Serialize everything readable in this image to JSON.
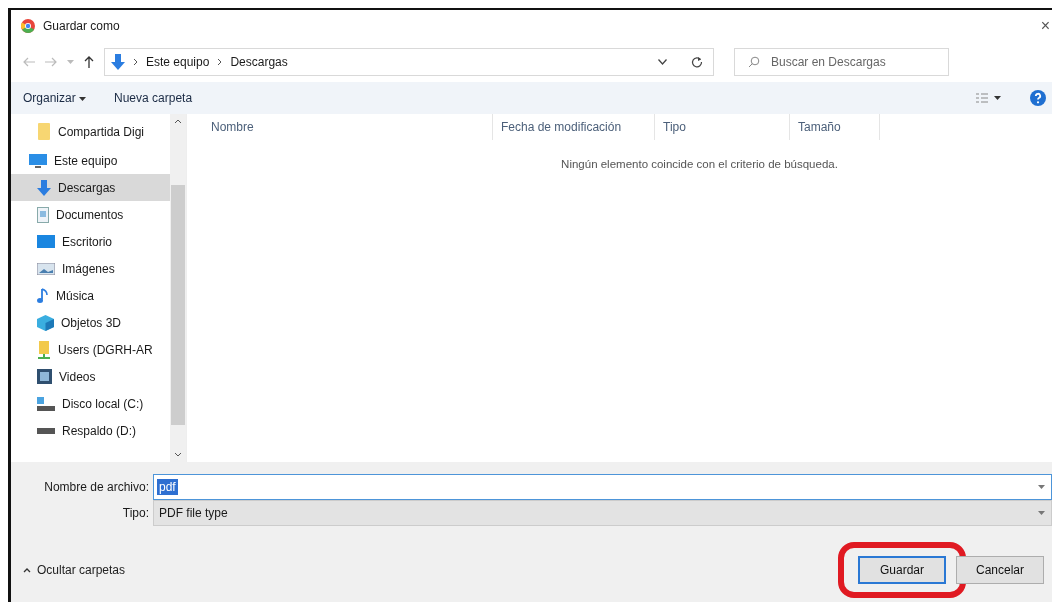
{
  "window": {
    "title": "Guardar como",
    "close": "×"
  },
  "address_bar": {
    "path": [
      {
        "label": "Este equipo"
      },
      {
        "label": "Descargas"
      }
    ],
    "search_placeholder": "Buscar en Descargas"
  },
  "toolbar": {
    "organize": "Organizar",
    "new_folder": "Nueva carpeta"
  },
  "sidebar": {
    "items": [
      {
        "label": "Compartida Digi",
        "kind": "folder",
        "selected": false
      },
      {
        "label": "Este equipo",
        "kind": "pc",
        "selected": false,
        "children": [
          {
            "label": "Descargas",
            "kind": "download",
            "selected": true
          },
          {
            "label": "Documentos",
            "kind": "document",
            "selected": false
          },
          {
            "label": "Escritorio",
            "kind": "desktop",
            "selected": false
          },
          {
            "label": "Imágenes",
            "kind": "images",
            "selected": false
          },
          {
            "label": "Música",
            "kind": "music",
            "selected": false
          },
          {
            "label": "Objetos 3D",
            "kind": "cube",
            "selected": false
          },
          {
            "label": "Users (DGRH-AR",
            "kind": "share",
            "selected": false
          },
          {
            "label": "Videos",
            "kind": "video",
            "selected": false
          },
          {
            "label": "Disco local (C:)",
            "kind": "disk",
            "selected": false
          },
          {
            "label": "Respaldo (D:)",
            "kind": "drive",
            "selected": false
          }
        ]
      }
    ]
  },
  "table": {
    "columns": [
      {
        "label": "Nombre"
      },
      {
        "label": "Fecha de modificación"
      },
      {
        "label": "Tipo"
      },
      {
        "label": "Tamaño"
      }
    ],
    "empty_message": "Ningún elemento coincide con el criterio de búsqueda."
  },
  "form": {
    "filename_label": "Nombre de archivo:",
    "filename": "pdf",
    "filename_text_selected": true,
    "type_label": "Tipo:",
    "type": "PDF file type"
  },
  "footer": {
    "hide_folders": "Ocultar carpetas",
    "buttons": [
      {
        "label": "Guardar",
        "highlighted": true,
        "default": true
      },
      {
        "label": "Cancelar",
        "highlighted": false,
        "default": false
      }
    ]
  }
}
